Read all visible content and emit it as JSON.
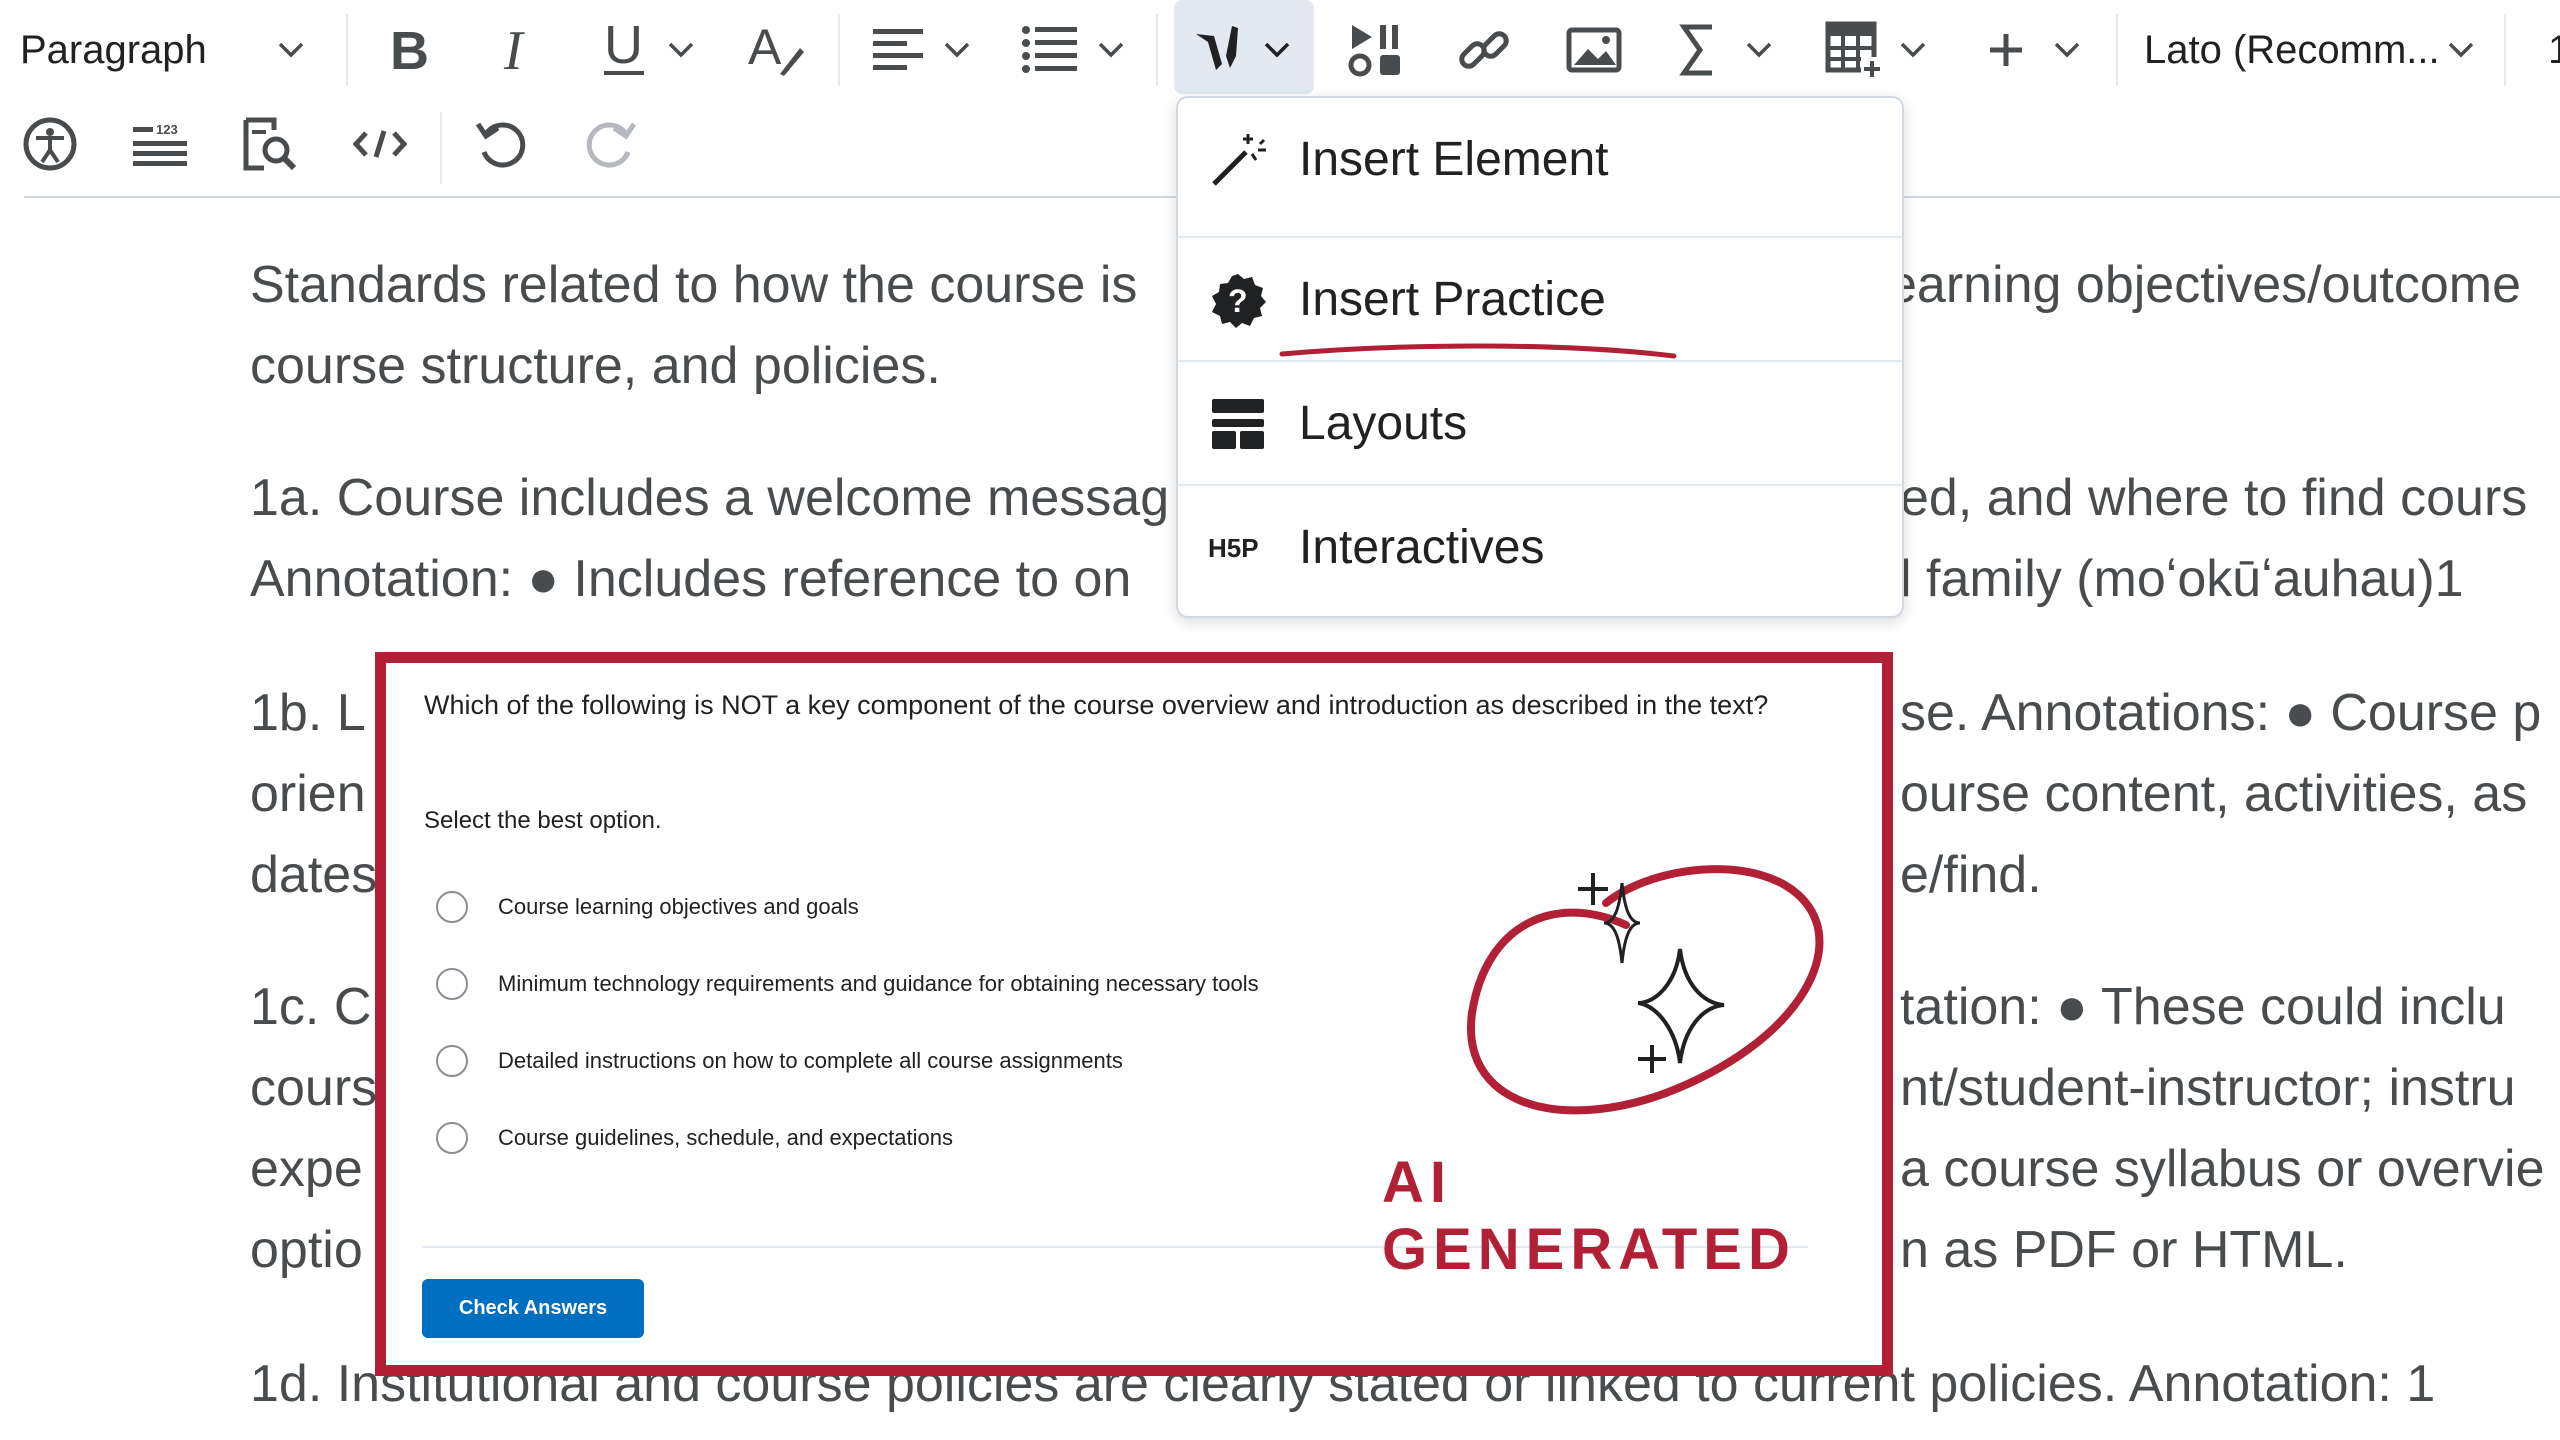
{
  "toolbar": {
    "paragraph_select": "Paragraph",
    "font_select": "Lato (Recomm...",
    "font_size_partial": "1",
    "icons": [
      "bold-icon",
      "italic-icon",
      "underline-icon",
      "text-color-icon",
      "align-icon",
      "list-icon",
      "insert-stuff-icon",
      "media-icon",
      "link-icon",
      "image-icon",
      "equation-icon",
      "table-icon",
      "plus-icon",
      "accessibility-icon",
      "word-count-icon",
      "find-icon",
      "source-code-icon",
      "undo-icon",
      "redo-icon"
    ]
  },
  "document": {
    "lines": [
      "Standards related to how the course is",
      "course structure, and policies.",
      "1a. Course includes a welcome messag",
      "Annotation: ● Includes reference to on",
      "1b. L",
      "orien",
      "dates",
      "1c. C",
      "cours",
      "expe",
      "optio",
      "1d. Institutional and course policies are clearly stated or linked to current policies. Annotation: 1"
    ],
    "right_fragments": [
      "earning objectives/outcome",
      "ed, and where to find cours",
      "l family (moʻokūʻauhau)1",
      "se. Annotations: ● Course p",
      "ourse content, activities, as",
      "e/find.",
      "tation: ● These could inclu",
      "nt/student-instructor; instru",
      "a course syllabus or overvie",
      "n as PDF or HTML."
    ]
  },
  "menu": {
    "items": [
      {
        "label": "Insert Element",
        "icon": "magic-wand-icon"
      },
      {
        "label": "Insert Practice",
        "icon": "question-badge-icon"
      },
      {
        "label": "Layouts",
        "icon": "layout-icon"
      },
      {
        "label": "Interactives",
        "icon": "h5p-icon"
      }
    ]
  },
  "quiz": {
    "question": "Which of the following is NOT a key component of the course overview and introduction as described in the text?",
    "instruction": "Select the best option.",
    "options": [
      "Course learning objectives and goals",
      "Minimum technology requirements and guidance for obtaining necessary tools",
      "Detailed instructions on how to complete all course assignments",
      "Course guidelines, schedule, and expectations"
    ],
    "check_button": "Check Answers",
    "badge_label": "AI GENERATED"
  },
  "colors": {
    "accent_red": "#b22036",
    "primary_blue": "#006fbf",
    "text_gray": "#494c4e",
    "active_bg": "#e3e9f1"
  }
}
